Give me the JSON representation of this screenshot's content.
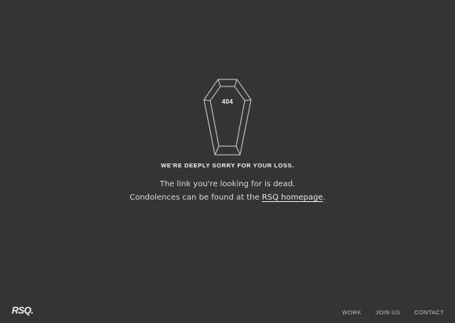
{
  "coffin": {
    "label": "404"
  },
  "headline": "WE'RE DEEPLY SORRY FOR YOUR LOSS.",
  "message": {
    "line1": "The link you're looking for is dead.",
    "line2_prefix": "Condolences can be found at the ",
    "link_text": "RSQ homepage",
    "line2_suffix": "."
  },
  "footer": {
    "logo": "RSQ.",
    "nav": [
      "WORK",
      "JOIN US",
      "CONTACT"
    ]
  },
  "colors": {
    "background": "#343434",
    "text": "#d9d9d9",
    "line": "#cfcfcf"
  }
}
